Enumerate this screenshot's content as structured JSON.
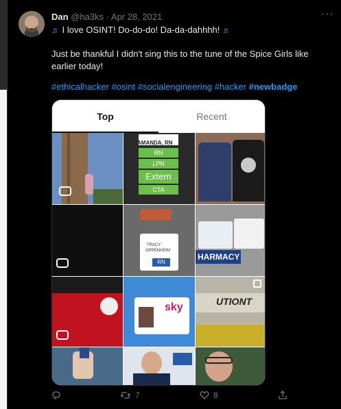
{
  "tweet": {
    "author_name": "Dan",
    "handle_date": "@ha3ks · Apr 28, 2021",
    "more_label": "···",
    "line1": "I love OSINT! Do-do-do! Da-da-dahhhh!",
    "line2": "Just be thankful I didn't sing this to the tune of the Spice Girls like earlier today!",
    "hashtags": "#ethicalhacker #osint #socialengineering #hacker",
    "hashtag_bold": "#newbadge",
    "music_icon": "♬"
  },
  "card": {
    "tab_top": "Top",
    "tab_recent": "Recent",
    "tiles": {
      "badge1": [
        "AMANDA, RN",
        "RN",
        "LPN",
        "Extern",
        "CTA"
      ],
      "badge2": [
        "TRACY",
        "OPPENHEIM",
        "RN"
      ],
      "pharmacy": "HARMACY",
      "sky": "sky",
      "station": "UTIONT"
    }
  },
  "actions": {
    "reply_count": "",
    "retweet_count": "7",
    "like_count": "8"
  }
}
